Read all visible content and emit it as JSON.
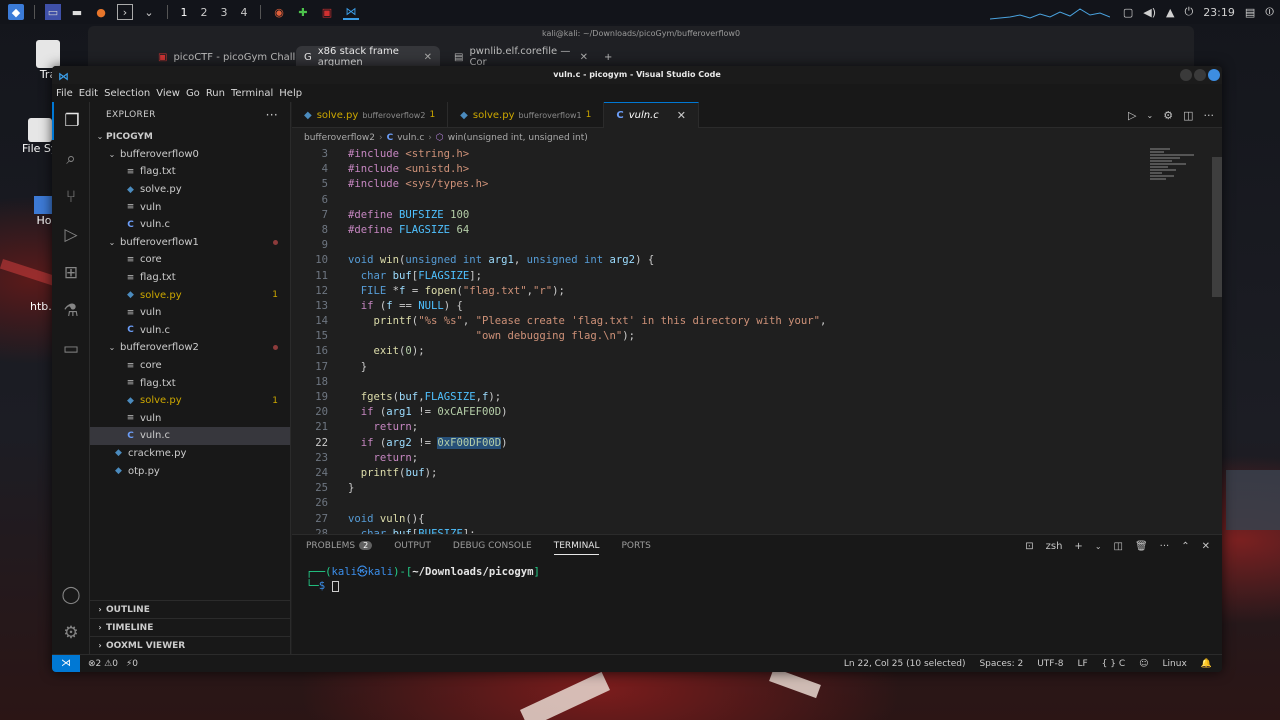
{
  "top_panel": {
    "workspaces": [
      "1",
      "2",
      "3",
      "4"
    ],
    "clock": "23:19"
  },
  "desktop_icons": [
    "Tra",
    "File Sy",
    "Ho",
    "htb.o"
  ],
  "browser": {
    "title": "kali@kali: ~/Downloads/picoGym/bufferoverflow0",
    "tabs": [
      {
        "label": "picoCTF - picoGym Challe",
        "active": false
      },
      {
        "label": "x86 stack frame argumen",
        "active": true
      },
      {
        "label": "pwnlib.elf.corefile — Cor",
        "active": false
      }
    ],
    "new_tab": "+"
  },
  "window": {
    "title": "vuln.c - picogym - Visual Studio Code",
    "menu": [
      "File",
      "Edit",
      "Selection",
      "View",
      "Go",
      "Run",
      "Terminal",
      "Help"
    ]
  },
  "explorer": {
    "header": "EXPLORER",
    "root": "PICOGYM",
    "items": [
      {
        "label": "bufferoverflow0",
        "type": "folder",
        "depth": 1,
        "status": ""
      },
      {
        "label": "flag.txt",
        "type": "txt",
        "depth": 2,
        "status": ""
      },
      {
        "label": "solve.py",
        "type": "py",
        "depth": 2,
        "status": ""
      },
      {
        "label": "vuln",
        "type": "txt",
        "depth": 2,
        "status": ""
      },
      {
        "label": "vuln.c",
        "type": "c",
        "depth": 2,
        "status": ""
      },
      {
        "label": "bufferoverflow1",
        "type": "folder",
        "depth": 1,
        "status": "dot"
      },
      {
        "label": "core",
        "type": "txt",
        "depth": 2,
        "status": ""
      },
      {
        "label": "flag.txt",
        "type": "txt",
        "depth": 2,
        "status": ""
      },
      {
        "label": "solve.py",
        "type": "py",
        "depth": 2,
        "status": "1"
      },
      {
        "label": "vuln",
        "type": "txt",
        "depth": 2,
        "status": ""
      },
      {
        "label": "vuln.c",
        "type": "c",
        "depth": 2,
        "status": ""
      },
      {
        "label": "bufferoverflow2",
        "type": "folder",
        "depth": 1,
        "status": "dot"
      },
      {
        "label": "core",
        "type": "txt",
        "depth": 2,
        "status": ""
      },
      {
        "label": "flag.txt",
        "type": "txt",
        "depth": 2,
        "status": ""
      },
      {
        "label": "solve.py",
        "type": "py",
        "depth": 2,
        "status": "1"
      },
      {
        "label": "vuln",
        "type": "txt",
        "depth": 2,
        "status": ""
      },
      {
        "label": "vuln.c",
        "type": "c",
        "depth": 2,
        "status": "",
        "selected": true
      },
      {
        "label": "crackme.py",
        "type": "py",
        "depth": 1,
        "status": ""
      },
      {
        "label": "otp.py",
        "type": "py",
        "depth": 1,
        "status": ""
      }
    ],
    "sections": [
      "OUTLINE",
      "TIMELINE",
      "OOXML VIEWER"
    ]
  },
  "editor": {
    "tabs": [
      {
        "name": "solve.py",
        "desc": "bufferoverflow2",
        "count": "1",
        "active": false
      },
      {
        "name": "solve.py",
        "desc": "bufferoverflow1",
        "count": "1",
        "active": false
      },
      {
        "name": "vuln.c",
        "desc": "",
        "count": "",
        "active": true
      }
    ],
    "breadcrumb": [
      "bufferoverflow2",
      "vuln.c",
      "win(unsigned int, unsigned int)"
    ],
    "current_line": "22",
    "code": [
      {
        "n": "3",
        "t": [
          [
            "pp",
            "#include "
          ],
          [
            "st",
            "<string.h>"
          ]
        ]
      },
      {
        "n": "4",
        "t": [
          [
            "pp",
            "#include "
          ],
          [
            "st",
            "<unistd.h>"
          ]
        ]
      },
      {
        "n": "5",
        "t": [
          [
            "pp",
            "#include "
          ],
          [
            "st",
            "<sys/types.h>"
          ]
        ]
      },
      {
        "n": "6",
        "t": []
      },
      {
        "n": "7",
        "t": [
          [
            "pp",
            "#define "
          ],
          [
            "mc",
            "BUFSIZE "
          ],
          [
            "nm",
            "100"
          ]
        ]
      },
      {
        "n": "8",
        "t": [
          [
            "pp",
            "#define "
          ],
          [
            "mc",
            "FLAGSIZE "
          ],
          [
            "nm",
            "64"
          ]
        ]
      },
      {
        "n": "9",
        "t": []
      },
      {
        "n": "10",
        "t": [
          [
            "ty",
            "void "
          ],
          [
            "fn",
            "win"
          ],
          [
            "",
            "("
          ],
          [
            "ty",
            "unsigned int "
          ],
          [
            "va",
            "arg1"
          ],
          [
            "",
            ", "
          ],
          [
            "ty",
            "unsigned int "
          ],
          [
            "va",
            "arg2"
          ],
          [
            "",
            ") {"
          ]
        ]
      },
      {
        "n": "11",
        "t": [
          [
            "",
            "  "
          ],
          [
            "ty",
            "char "
          ],
          [
            "va",
            "buf"
          ],
          [
            "",
            "["
          ],
          [
            "mc",
            "FLAGSIZE"
          ],
          [
            "",
            "];"
          ]
        ]
      },
      {
        "n": "12",
        "t": [
          [
            "",
            "  "
          ],
          [
            "ty",
            "FILE "
          ],
          [
            "",
            "*"
          ],
          [
            "va",
            "f"
          ],
          [
            "",
            " = "
          ],
          [
            "fn",
            "fopen"
          ],
          [
            "",
            "("
          ],
          [
            "st",
            "\"flag.txt\""
          ],
          [
            "",
            ","
          ],
          [
            "st",
            "\"r\""
          ],
          [
            "",
            ");"
          ]
        ]
      },
      {
        "n": "13",
        "t": [
          [
            "",
            "  "
          ],
          [
            "ct",
            "if "
          ],
          [
            "",
            "("
          ],
          [
            "va",
            "f"
          ],
          [
            "",
            " == "
          ],
          [
            "mc",
            "NULL"
          ],
          [
            "",
            ") {"
          ]
        ]
      },
      {
        "n": "14",
        "t": [
          [
            "",
            "    "
          ],
          [
            "fn",
            "printf"
          ],
          [
            "",
            "("
          ],
          [
            "st",
            "\"%s %s\""
          ],
          [
            "",
            ", "
          ],
          [
            "st",
            "\"Please create 'flag.txt' in this directory with your\""
          ],
          [
            "",
            ","
          ]
        ]
      },
      {
        "n": "15",
        "t": [
          [
            "",
            "                    "
          ],
          [
            "st",
            "\"own debugging flag.\\n\""
          ],
          [
            "",
            ");"
          ]
        ]
      },
      {
        "n": "16",
        "t": [
          [
            "",
            "    "
          ],
          [
            "fn",
            "exit"
          ],
          [
            "",
            "("
          ],
          [
            "nm",
            "0"
          ],
          [
            "",
            ");"
          ]
        ]
      },
      {
        "n": "17",
        "t": [
          [
            "",
            "  }"
          ]
        ]
      },
      {
        "n": "18",
        "t": []
      },
      {
        "n": "19",
        "t": [
          [
            "",
            "  "
          ],
          [
            "fn",
            "fgets"
          ],
          [
            "",
            "("
          ],
          [
            "va",
            "buf"
          ],
          [
            "",
            ","
          ],
          [
            "mc",
            "FLAGSIZE"
          ],
          [
            "",
            ","
          ],
          [
            "va",
            "f"
          ],
          [
            "",
            ");"
          ]
        ]
      },
      {
        "n": "20",
        "t": [
          [
            "",
            "  "
          ],
          [
            "ct",
            "if "
          ],
          [
            "",
            "("
          ],
          [
            "va",
            "arg1"
          ],
          [
            "",
            " != "
          ],
          [
            "nm",
            "0xCAFEF00D"
          ],
          [
            "",
            ")"
          ]
        ]
      },
      {
        "n": "21",
        "t": [
          [
            "",
            "    "
          ],
          [
            "ct",
            "return"
          ],
          [
            "",
            ";"
          ]
        ]
      },
      {
        "n": "22",
        "t": [
          [
            "",
            "  "
          ],
          [
            "ct",
            "if "
          ],
          [
            "",
            "("
          ],
          [
            "va",
            "arg2"
          ],
          [
            "",
            " != "
          ],
          [
            "nm sel",
            "0xF00DF00D"
          ],
          [
            "",
            ")"
          ]
        ]
      },
      {
        "n": "23",
        "t": [
          [
            "",
            "    "
          ],
          [
            "ct",
            "return"
          ],
          [
            "",
            ";"
          ]
        ]
      },
      {
        "n": "24",
        "t": [
          [
            "",
            "  "
          ],
          [
            "fn",
            "printf"
          ],
          [
            "",
            "("
          ],
          [
            "va",
            "buf"
          ],
          [
            "",
            ");"
          ]
        ]
      },
      {
        "n": "25",
        "t": [
          [
            "",
            "}"
          ]
        ]
      },
      {
        "n": "26",
        "t": []
      },
      {
        "n": "27",
        "t": [
          [
            "ty",
            "void "
          ],
          [
            "fn",
            "vuln"
          ],
          [
            "",
            "(){"
          ]
        ]
      },
      {
        "n": "28",
        "t": [
          [
            "",
            "  "
          ],
          [
            "ty",
            "char "
          ],
          [
            "va",
            "buf"
          ],
          [
            "",
            "["
          ],
          [
            "mc",
            "BUFSIZE"
          ],
          [
            "",
            "];"
          ]
        ]
      }
    ]
  },
  "panel": {
    "tabs": [
      "PROBLEMS",
      "OUTPUT",
      "DEBUG CONSOLE",
      "TERMINAL",
      "PORTS"
    ],
    "problems_count": "2",
    "active_tab": "TERMINAL",
    "shell": "zsh",
    "terminal": {
      "user": "kali",
      "at": "㉿",
      "host": "kali",
      "path": "~/Downloads/picogym",
      "prompt": "$"
    }
  },
  "statusbar": {
    "errors": "2",
    "warnings": "0",
    "ports": "0",
    "position": "Ln 22, Col 25 (10 selected)",
    "spaces": "Spaces: 2",
    "encoding": "UTF-8",
    "eol": "LF",
    "language": "C",
    "platform": "Linux"
  }
}
